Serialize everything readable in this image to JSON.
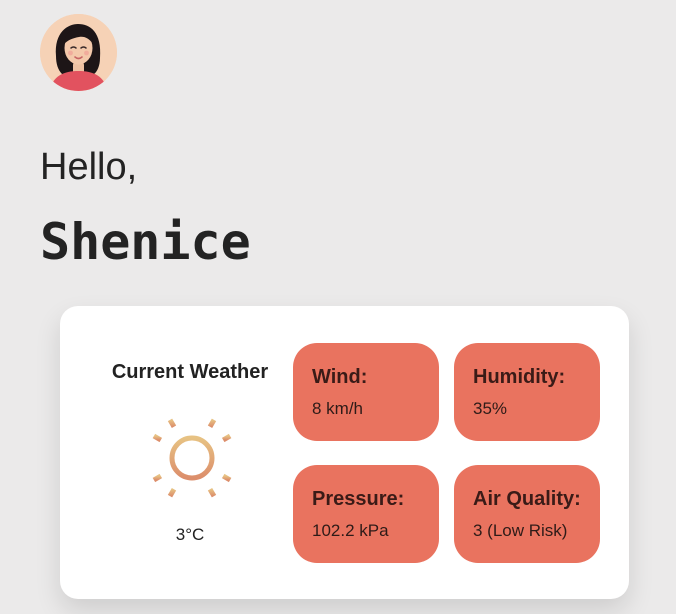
{
  "user": {
    "greeting": "Hello,",
    "name": "Shenice",
    "avatar_icon": "user-avatar-icon"
  },
  "weather": {
    "title": "Current Weather",
    "icon": "sun-icon",
    "temperature": "3°C",
    "metrics": [
      {
        "label": "Wind:",
        "value": "8 km/h"
      },
      {
        "label": "Humidity:",
        "value": "35%"
      },
      {
        "label": "Pressure:",
        "value": "102.2 kPa"
      },
      {
        "label": "Air Quality:",
        "value": "3 (Low Risk)"
      }
    ]
  },
  "colors": {
    "background": "#ebeaea",
    "card": "#ffffff",
    "tile": "#e9735f",
    "sun_top": "#e7c283",
    "sun_bottom": "#dc8e6b"
  }
}
